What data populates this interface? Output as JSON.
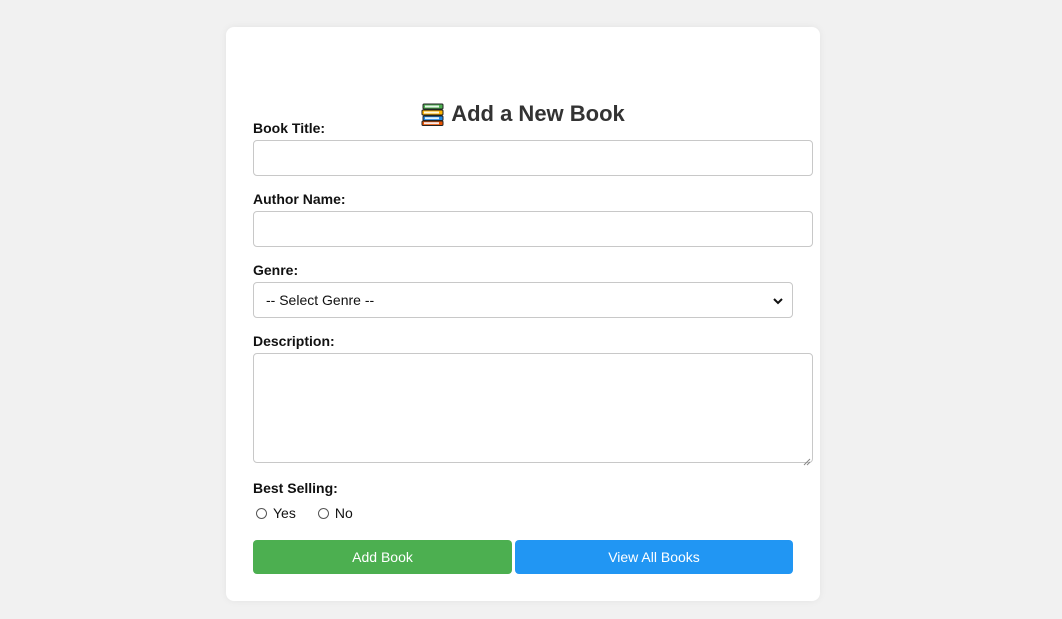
{
  "form": {
    "title": "Add a New Book",
    "title_icon": "books-icon",
    "fields": {
      "book_title": {
        "label": "Book Title:",
        "value": ""
      },
      "author_name": {
        "label": "Author Name:",
        "value": ""
      },
      "genre": {
        "label": "Genre:",
        "selected": "-- Select Genre --"
      },
      "description": {
        "label": "Description:",
        "value": ""
      },
      "best_selling": {
        "label": "Best Selling:",
        "options": [
          {
            "label": "Yes",
            "checked": false
          },
          {
            "label": "No",
            "checked": false
          }
        ]
      }
    },
    "buttons": {
      "add": "Add Book",
      "view_all": "View All Books"
    }
  },
  "colors": {
    "background": "#f1f1f1",
    "card": "#ffffff",
    "add_button": "#4caf50",
    "view_button": "#2196f3"
  }
}
